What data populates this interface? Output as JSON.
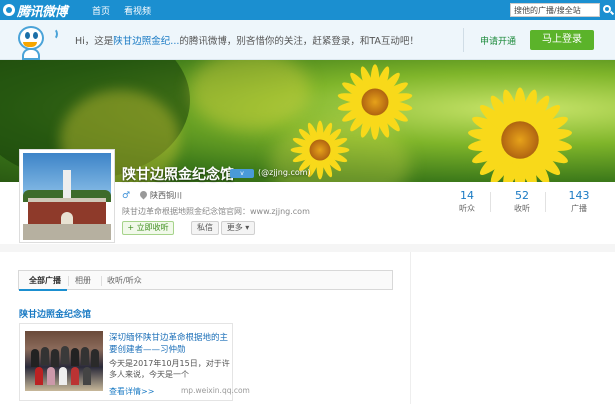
{
  "topnav": {
    "logo": "腾讯微博",
    "links": [
      "首页",
      "看视频"
    ],
    "search_value": "搜他的广播/搜全站"
  },
  "invite": {
    "text_before": "Hi，这是",
    "username": "陕甘边照金纪...",
    "text_after": "的腾讯微博，别吝惜你的关注，赶紧登录，和TA互动吧！",
    "apply_label": "申请开通",
    "login_label": "马上登录"
  },
  "profile": {
    "name": "陕甘边照金纪念馆",
    "badge": "v",
    "handle": "(@zjjng.com)",
    "gender_symbol": "♂",
    "location": "陕西铜川",
    "bio": "陕甘边革命根据地照金纪念馆官网：www.zjjng.com",
    "follow_label": "+ 立即收听",
    "message_label": "私信",
    "more_label": "更多 ▾",
    "stats": [
      {
        "num": "14",
        "label": "听众"
      },
      {
        "num": "52",
        "label": "收听"
      },
      {
        "num": "143",
        "label": "广播"
      }
    ]
  },
  "timeline": {
    "tabs": [
      "全部广播",
      "相册",
      "收听/听众"
    ],
    "post": {
      "author": "陕甘边照金纪念馆",
      "card_title": "深切缅怀陕甘边革命根据地的主要创建者——习仲勋",
      "card_desc": "今天是2017年10月15日，对于许多人来说，今天是一个",
      "card_more": "查看详情>>",
      "card_source": "mp.weixin.qq.com"
    }
  },
  "colors": {
    "nav_blue": "#1b8fd0",
    "link_blue": "#1b7bc4",
    "login_green": "#5bb32a",
    "flower_yellow": "#f8d91a"
  }
}
